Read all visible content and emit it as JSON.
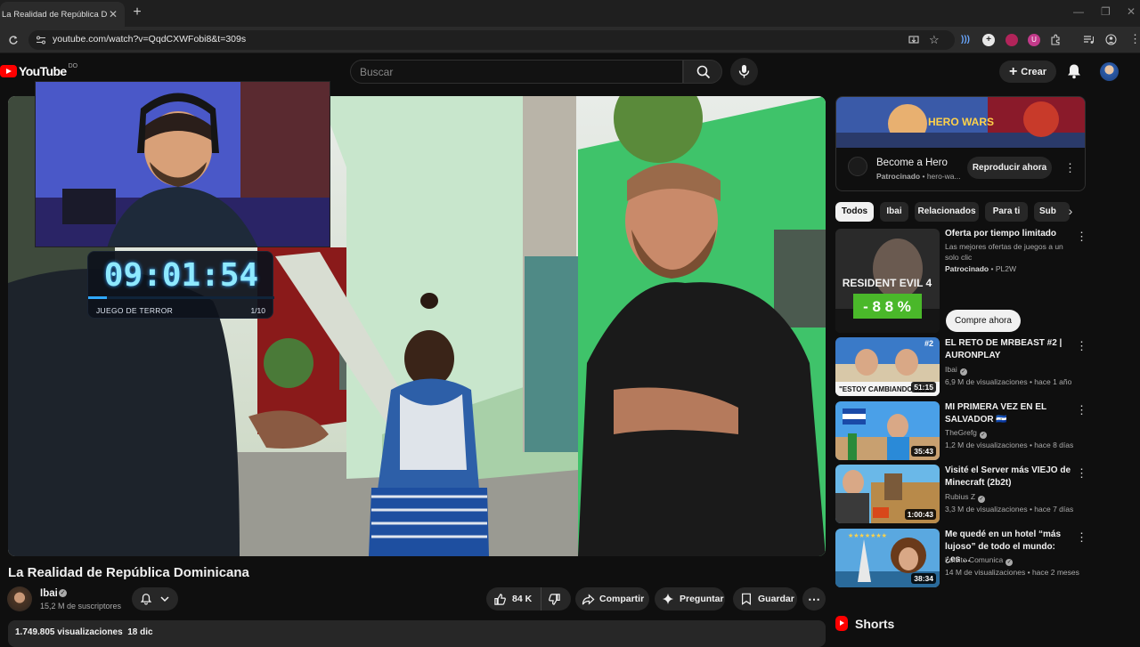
{
  "browser": {
    "tab_title": "La Realidad de República Domi",
    "url": "youtube.com/watch?v=QqdCXWFobi8&t=309s"
  },
  "header": {
    "logo_text": "YouTube",
    "logo_country": "DO",
    "search_placeholder": "Buscar",
    "create_label": "Crear"
  },
  "overlay": {
    "timer": "09:01:54",
    "label": "JUEGO DE TERROR",
    "count": "1/10",
    "progress_fraction": 0.1
  },
  "video": {
    "title": "La Realidad de República Dominicana",
    "channel": "Ibai",
    "subscribers": "15,2 M de suscriptores",
    "likes": "84 K",
    "share_label": "Compartir",
    "ask_label": "Preguntar",
    "save_label": "Guardar",
    "views": "1.749.805 visualizaciones",
    "date": "18 dic"
  },
  "ad": {
    "title": "Become a Hero",
    "sponsored": "Patrocinado",
    "domain": "hero-wa...",
    "cta": "Reproducir ahora",
    "banner_text": "HERO WARS"
  },
  "chips": [
    "Todos",
    "Ibai",
    "Relacionados",
    "Para ti",
    "Sub"
  ],
  "sidebar": {
    "promo": {
      "title": "Oferta por tiempo limitado",
      "desc": "Las mejores ofertas de juegos a un solo clic",
      "sponsored": "Patrocinado",
      "advertiser": "PL2W",
      "cta": "Compre ahora",
      "thumb_text": "RESIDENT EVIL 4",
      "discount": "- 8 8 %"
    },
    "videos": [
      {
        "title": "EL RETO DE MRBEAST #2 | AURONPLAY",
        "channel": "Ibai",
        "meta": "6,9 M de visualizaciones • hace 1 año",
        "duration": "51:15",
        "thumb_text": "\"ESTOY CAMBIANDO MUC",
        "badge": "#2"
      },
      {
        "title": "MI PRIMERA VEZ EN EL SALVADOR 🇸🇻",
        "channel": "TheGrefg",
        "meta": "1,2 M de visualizaciones • hace 8 días",
        "duration": "35:43"
      },
      {
        "title": "Visité el Server más VIEJO de Minecraft (2b2t)",
        "channel": "Rubius Z",
        "meta": "3,3 M de visualizaciones • hace 7 días",
        "duration": "1:00:43"
      },
      {
        "title": "Me quedé en un hotel “más lujoso” de todo el mundo: ¿es ...",
        "channel": "Luisito Comunica",
        "meta": "14 M de visualizaciones • hace 2 meses",
        "duration": "38:34"
      }
    ]
  },
  "shorts_label": "Shorts",
  "colors": {
    "yt_red": "#ff0000",
    "timer_cyan": "#8ee9ff",
    "bg": "#0f0f0f"
  }
}
